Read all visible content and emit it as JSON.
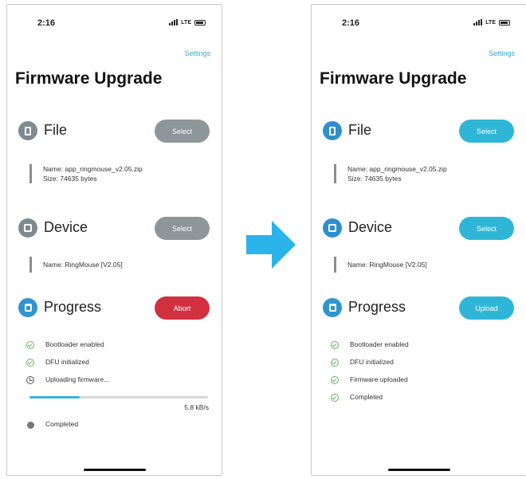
{
  "colors": {
    "accent_blue": "#3aa7c9",
    "button_disabled_gray": "#8d969b",
    "abort_red": "#d13040",
    "button_active_teal": "#2fb6d6",
    "section_icon_gray": "#7d8a90",
    "section_icon_blue": "#2e8fcf",
    "progress_icon_blue": "#2f95cf",
    "success_green": "#5cb85c",
    "arrow_blue": "#2ab4ea"
  },
  "screens": [
    {
      "time": "2:16",
      "network": "LTE",
      "settings_label": "Settings",
      "title": "Firmware Upgrade",
      "file": {
        "title": "File",
        "button": "Select",
        "button_state": "disabled",
        "name": "Name: app_ringmouse_v2.05.zip",
        "size": "Size: 74635 bytes"
      },
      "device": {
        "title": "Device",
        "button": "Select",
        "button_state": "disabled",
        "name": "Name: RingMouse [V2.05]"
      },
      "progress": {
        "title": "Progress",
        "button": "Abort",
        "button_state": "abort",
        "steps": [
          {
            "label": "Bootloader enabled",
            "status": "done",
            "icon": "check-circle-icon"
          },
          {
            "label": "DFU initialized",
            "status": "done",
            "icon": "check-circle-icon"
          },
          {
            "label": "Uploading firmware...",
            "status": "in-progress",
            "icon": "spinner-icon"
          },
          {
            "label": "Completed",
            "status": "pending",
            "icon": "dot-icon"
          }
        ],
        "upload_fraction": 0.28,
        "speed": "5.8 kB/s"
      }
    },
    {
      "time": "2:16",
      "network": "LTE",
      "settings_label": "Settings",
      "title": "Firmware Upgrade",
      "file": {
        "title": "File",
        "button": "Select",
        "button_state": "active",
        "name": "Name: app_ringmouse_v2.05.zip",
        "size": "Size: 74635 bytes"
      },
      "device": {
        "title": "Device",
        "button": "Select",
        "button_state": "active",
        "name": "Name: RingMouse [V2.05]"
      },
      "progress": {
        "title": "Progress",
        "button": "Upload",
        "button_state": "active",
        "steps": [
          {
            "label": "Bootloader enabled",
            "status": "done",
            "icon": "check-circle-icon"
          },
          {
            "label": "DFU initialized",
            "status": "done",
            "icon": "check-circle-icon"
          },
          {
            "label": "Firmware uploaded",
            "status": "done",
            "icon": "check-circle-icon"
          },
          {
            "label": "Completed",
            "status": "done",
            "icon": "check-circle-icon"
          }
        ]
      }
    }
  ]
}
